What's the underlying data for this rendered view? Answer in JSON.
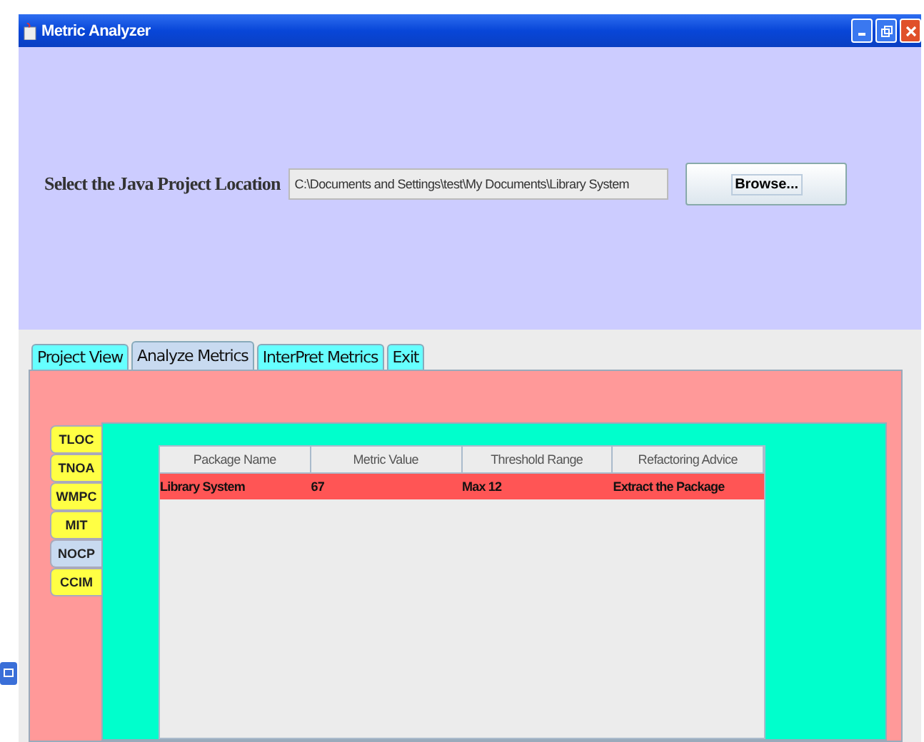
{
  "window": {
    "title": "Metric Analyzer"
  },
  "location": {
    "label": "Select the Java Project Location",
    "value": "C:\\Documents and Settings\\test\\My Documents\\Library System",
    "button": "Browse..."
  },
  "tabs": [
    {
      "label": "Project View",
      "selected": false
    },
    {
      "label": "Analyze Metrics",
      "selected": true
    },
    {
      "label": "InterPret Metrics",
      "selected": false
    },
    {
      "label": "Exit",
      "selected": false
    }
  ],
  "metric_tabs": [
    {
      "label": "TLOC",
      "selected": false
    },
    {
      "label": "TNOA",
      "selected": false
    },
    {
      "label": "WMPC",
      "selected": false
    },
    {
      "label": "MIT",
      "selected": false
    },
    {
      "label": "NOCP",
      "selected": true
    },
    {
      "label": "CCIM",
      "selected": false
    }
  ],
  "table": {
    "columns": [
      "Package Name",
      "Metric Value",
      "Threshold Range",
      "Refactoring Advice"
    ],
    "rows": [
      {
        "cells": [
          "Library System",
          "67",
          "Max 12",
          "Extract the Package"
        ],
        "selected": true
      }
    ]
  }
}
